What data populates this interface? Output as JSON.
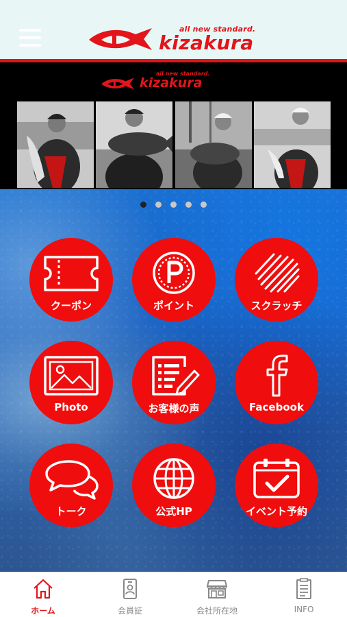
{
  "header": {
    "menu_icon": "hamburger-menu-icon",
    "logo_tagline": "all new standard.",
    "logo_text": "kizakura"
  },
  "banner": {
    "logo_tagline": "all new standard.",
    "logo_text": "kizakura",
    "photos": [
      "angler-photo-1",
      "angler-photo-2",
      "angler-photo-3",
      "angler-photo-4"
    ],
    "page_count": 5,
    "active_page": 1
  },
  "menu": {
    "items": [
      {
        "label": "クーポン",
        "icon": "ticket-icon"
      },
      {
        "label": "ポイント",
        "icon": "point-p-icon"
      },
      {
        "label": "スクラッチ",
        "icon": "scratch-icon"
      },
      {
        "label": "Photo",
        "icon": "photo-icon"
      },
      {
        "label": "お客様の声",
        "icon": "review-icon"
      },
      {
        "label": "Facebook",
        "icon": "facebook-icon"
      },
      {
        "label": "トーク",
        "icon": "chat-icon"
      },
      {
        "label": "公式HP",
        "icon": "globe-icon"
      },
      {
        "label": "イベント予約",
        "icon": "calendar-check-icon"
      }
    ]
  },
  "tabbar": {
    "items": [
      {
        "label": "ホーム",
        "icon": "home-icon",
        "active": true
      },
      {
        "label": "会員証",
        "icon": "member-card-icon",
        "active": false
      },
      {
        "label": "会社所在地",
        "icon": "store-icon",
        "active": false
      },
      {
        "label": "INFO",
        "icon": "info-document-icon",
        "active": false
      }
    ]
  },
  "colors": {
    "brand_red": "#e3141a",
    "tile_red": "#f00d0d",
    "header_bg": "#e8f7f5",
    "inactive_tab": "#888888"
  }
}
